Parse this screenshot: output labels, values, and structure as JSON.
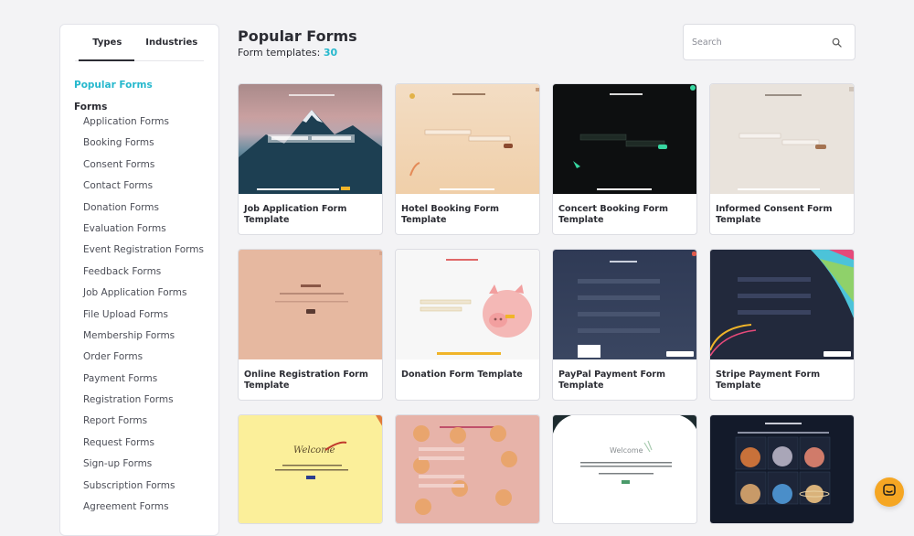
{
  "sidebar": {
    "tabs": [
      {
        "label": "Types",
        "active": true
      },
      {
        "label": "Industries",
        "active": false
      }
    ],
    "popular_label": "Popular Forms",
    "section_heading": "Forms",
    "items": [
      {
        "label": "Application Forms"
      },
      {
        "label": "Booking Forms"
      },
      {
        "label": "Consent Forms"
      },
      {
        "label": "Contact Forms"
      },
      {
        "label": "Donation Forms"
      },
      {
        "label": "Evaluation Forms"
      },
      {
        "label": "Event Registration Forms"
      },
      {
        "label": "Feedback Forms"
      },
      {
        "label": "Job Application Forms"
      },
      {
        "label": "File Upload Forms"
      },
      {
        "label": "Membership Forms"
      },
      {
        "label": "Order Forms"
      },
      {
        "label": "Payment Forms"
      },
      {
        "label": "Registration Forms"
      },
      {
        "label": "Report Forms"
      },
      {
        "label": "Request Forms"
      },
      {
        "label": "Sign-up Forms"
      },
      {
        "label": "Subscription Forms"
      },
      {
        "label": "Agreement Forms"
      }
    ]
  },
  "header": {
    "title": "Popular Forms",
    "templates_label": "Form templates:",
    "templates_count": "30"
  },
  "search": {
    "placeholder": "Search",
    "value": "",
    "icon": "search-icon"
  },
  "cards": [
    {
      "title": "Job Application Form Template",
      "thumb": "mountain"
    },
    {
      "title": "Hotel Booking Form Template",
      "thumb": "peach"
    },
    {
      "title": "Concert Booking Form Template",
      "thumb": "dark"
    },
    {
      "title": "Informed Consent Form Template",
      "thumb": "beige"
    },
    {
      "title": "Online Registration Form Template",
      "thumb": "salmon"
    },
    {
      "title": "Donation Form Template",
      "thumb": "piggy"
    },
    {
      "title": "PayPal Payment Form Template",
      "thumb": "navy"
    },
    {
      "title": "Stripe Payment Form Template",
      "thumb": "navy-colorful"
    },
    {
      "title": "",
      "thumb": "yellow-welcome"
    },
    {
      "title": "",
      "thumb": "pink-cookies"
    },
    {
      "title": "",
      "thumb": "white-welcome"
    },
    {
      "title": "",
      "thumb": "space-planets"
    }
  ],
  "thumb_text": {
    "welcome": "Welcome",
    "welcome_script": "Welcome"
  },
  "chat": {
    "icon": "chat-icon"
  },
  "colors": {
    "accent": "#26b8cd",
    "chat_button": "#f5a623"
  }
}
